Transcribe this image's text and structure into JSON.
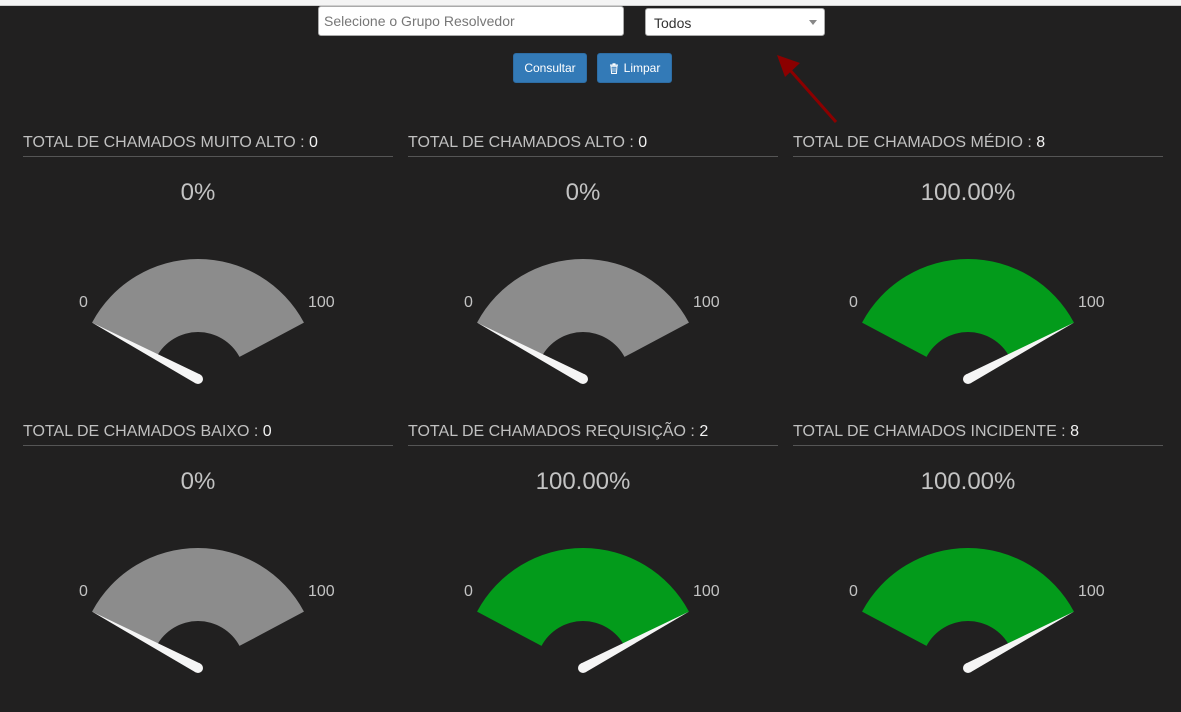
{
  "filters": {
    "group_placeholder": "Selecione o Grupo Resolvedor",
    "select_value": "Todos",
    "consultar_label": "Consultar",
    "limpar_label": "Limpar"
  },
  "colors": {
    "gauge_filled": "#039b1b",
    "gauge_empty": "#8c8c8c",
    "needle": "#f5f5f5",
    "arrow": "#8b0000",
    "button": "#337ab7"
  },
  "gauges": [
    {
      "title": "TOTAL DE CHAMADOS MUITO ALTO : ",
      "count": "0",
      "percent_label": "0%",
      "value": 0,
      "min_label": "0",
      "max_label": "100"
    },
    {
      "title": "TOTAL DE CHAMADOS ALTO : ",
      "count": "0",
      "percent_label": "0%",
      "value": 0,
      "min_label": "0",
      "max_label": "100"
    },
    {
      "title": "TOTAL DE CHAMADOS MÉDIO : ",
      "count": "8",
      "percent_label": "100.00%",
      "value": 100,
      "min_label": "0",
      "max_label": "100"
    },
    {
      "title": "TOTAL DE CHAMADOS BAIXO : ",
      "count": "0",
      "percent_label": "0%",
      "value": 0,
      "min_label": "0",
      "max_label": "100"
    },
    {
      "title": "TOTAL DE CHAMADOS REQUISIÇÃO : ",
      "count": "2",
      "percent_label": "100.00%",
      "value": 100,
      "min_label": "0",
      "max_label": "100"
    },
    {
      "title": "TOTAL DE CHAMADOS INCIDENTE : ",
      "count": "8",
      "percent_label": "100.00%",
      "value": 100,
      "min_label": "0",
      "max_label": "100"
    }
  ]
}
